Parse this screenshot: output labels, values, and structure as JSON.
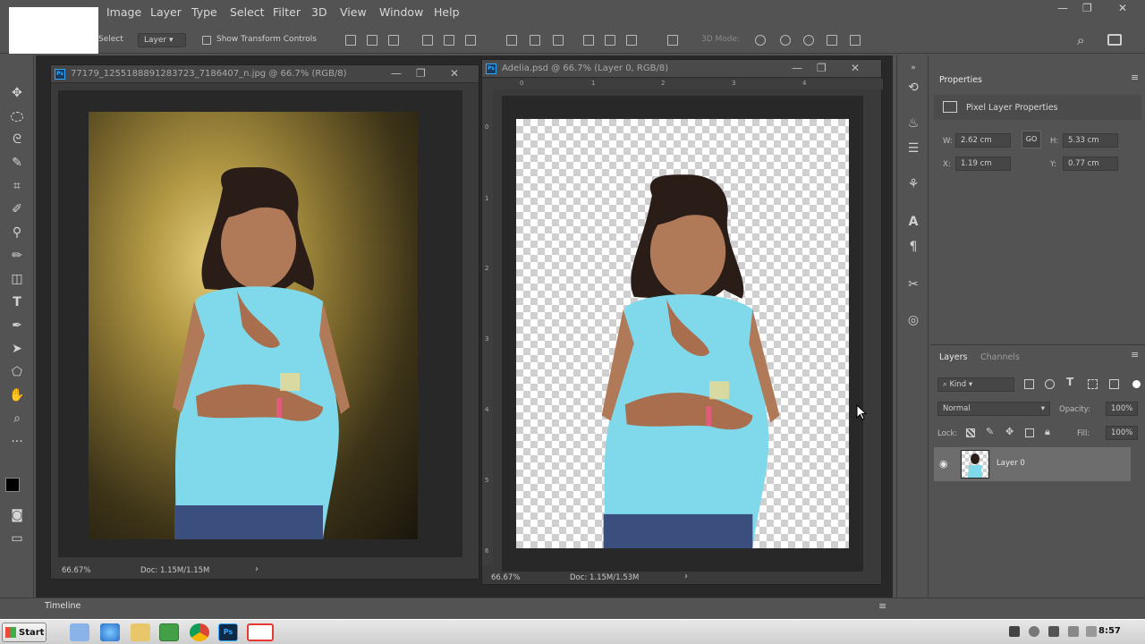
{
  "menu": {
    "items": [
      "Image",
      "Layer",
      "Type",
      "Select",
      "Filter",
      "3D",
      "View",
      "Window",
      "Help"
    ],
    "window_controls": {
      "minimize": "—",
      "restore": "❐",
      "close": "✕"
    }
  },
  "options_bar": {
    "auto_select_label": "Select",
    "target_value": "Layer",
    "show_transform_label": "Show Transform Controls",
    "mode_3d_label": "3D Mode:"
  },
  "documents": [
    {
      "title": "77179_1255188891283723_7186407_n.jpg @ 66.7% (RGB/8)",
      "zoom": "66.67%",
      "doc_size": "Doc: 1.15M/1.15M"
    },
    {
      "title": "Adelia.psd @ 66.7% (Layer 0, RGB/8)",
      "zoom": "66.67%",
      "doc_size": "Doc: 1.15M/1.53M",
      "ruler_top": [
        "0",
        "1",
        "2",
        "3",
        "4"
      ],
      "ruler_left": [
        "0",
        "1",
        "2",
        "3",
        "4",
        "5",
        "6"
      ]
    }
  ],
  "properties": {
    "tab": "Properties",
    "heading": "Pixel Layer Properties",
    "w_label": "W:",
    "w_value": "2.62 cm",
    "h_label": "H:",
    "h_value": "5.33 cm",
    "x_label": "X:",
    "x_value": "1.19 cm",
    "y_label": "Y:",
    "y_value": "0.77 cm",
    "link_label": "GO"
  },
  "layers_panel": {
    "tabs": [
      "Layers",
      "Channels"
    ],
    "kind_label": "Kind",
    "blend_mode": "Normal",
    "opacity_label": "Opacity:",
    "opacity_value": "100%",
    "lock_label": "Lock:",
    "fill_label": "Fill:",
    "fill_value": "100%",
    "layer_name": "Layer 0",
    "bottom_icons": [
      "link-icon",
      "fx-icon",
      "mask-icon",
      "adjustment-icon",
      "group-icon",
      "new-layer-icon",
      "trash-icon"
    ]
  },
  "timeline": {
    "label": "Timeline"
  },
  "taskbar": {
    "start_label": "Start",
    "clock": "8:57"
  },
  "colors": {
    "ps_accent": "#31a8ff",
    "panel_bg": "#535353",
    "canvas_bg": "#282828"
  }
}
